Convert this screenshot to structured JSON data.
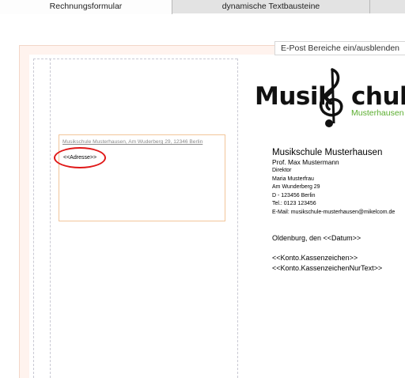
{
  "tabs": [
    {
      "label": "Rechnungsformular"
    },
    {
      "label": "dynamische Textbausteine"
    },
    {
      "label": ""
    }
  ],
  "toolbar": {
    "toggle_label": "E-Post Bereiche ein/ausblenden"
  },
  "logo": {
    "word_left": "Musik",
    "word_right": "chule",
    "subtitle": "Musterhausen",
    "icon": "treble-clef-icon",
    "accent_color": "#5aae2e"
  },
  "address_window": {
    "sender_line": "Musikschule Musterhausen, Am Wuderberg 29, 12346 Berlin",
    "placeholder": "<<Adresse>>",
    "highlight_color": "#e01818"
  },
  "sender": {
    "org": "Musikschule Musterhausen",
    "name": "Prof. Max Mustermann",
    "title": "Direktor",
    "contact": "Maria Musterfrau",
    "street": "Am Wunderberg 29",
    "city": "D - 123456 Berlin",
    "phone": "Tel.: 0123 123456",
    "email": "E-Mail: musikschule-musterhausen@mikelcom.de"
  },
  "letter": {
    "date_line": "Oldenburg, den <<Datum>>",
    "ref_1": "<<Konto.Kassenzeichen>>",
    "ref_2": "<<Konto.KassenzeichenNurText>>"
  }
}
